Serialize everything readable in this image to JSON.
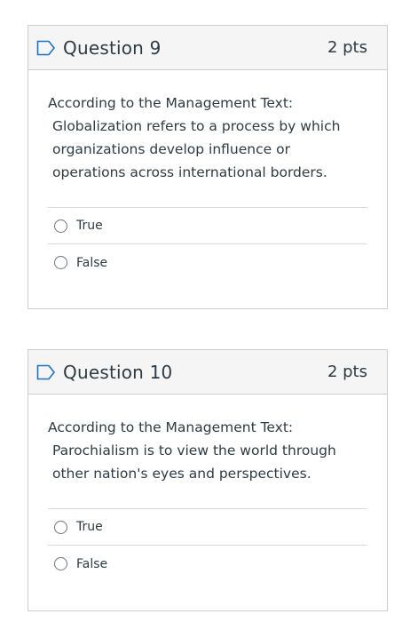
{
  "questions": [
    {
      "title": "Question 9",
      "points": "2 pts",
      "text_line1": "According to the Management Text:",
      "text_line2": "Globalization refers to a process by which organizations develop influence or operations across international borders.",
      "answers": [
        "True",
        "False"
      ]
    },
    {
      "title": "Question 10",
      "points": "2 pts",
      "text_line1": "According to the Management Text:",
      "text_line2": "Parochialism is to view the world through other nation's eyes and perspectives.",
      "answers": [
        "True",
        "False"
      ]
    }
  ],
  "colors": {
    "flag": "#1a73c9",
    "border": "#c7cdd1",
    "header_bg": "#f5f5f5",
    "text": "#2d3b45"
  },
  "icons": {
    "flag": "flag-outline-icon",
    "radio": "radio-empty-icon"
  }
}
